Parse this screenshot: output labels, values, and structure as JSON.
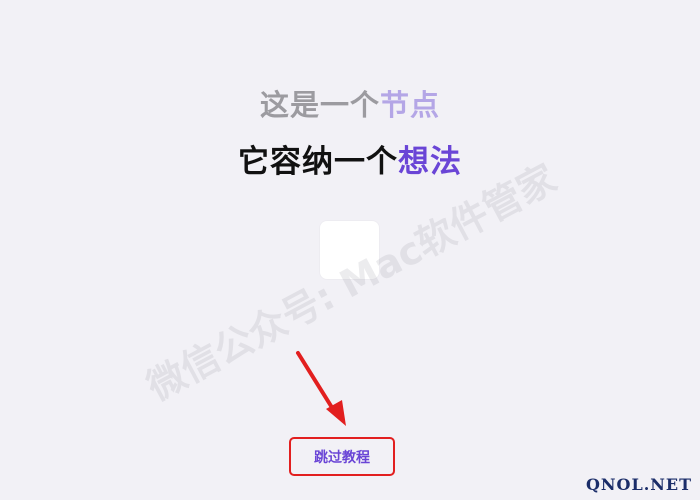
{
  "headline": {
    "line1_prefix": "这是一个",
    "line1_accent": "节点",
    "line2_prefix": "它容纳一个",
    "line2_accent": "想法"
  },
  "overlay": {
    "watermark_text": "微信公众号: Mac软件管家",
    "site_text": "QNOL.NET"
  },
  "actions": {
    "skip_tutorial": "跳过教程"
  },
  "colors": {
    "background": "#f2f1f6",
    "accent": "#6a45d6",
    "accent_light": "#b4a6e6",
    "highlight_red": "#e21f1f"
  },
  "icons": {
    "arrow": "arrow-down-right-icon"
  }
}
